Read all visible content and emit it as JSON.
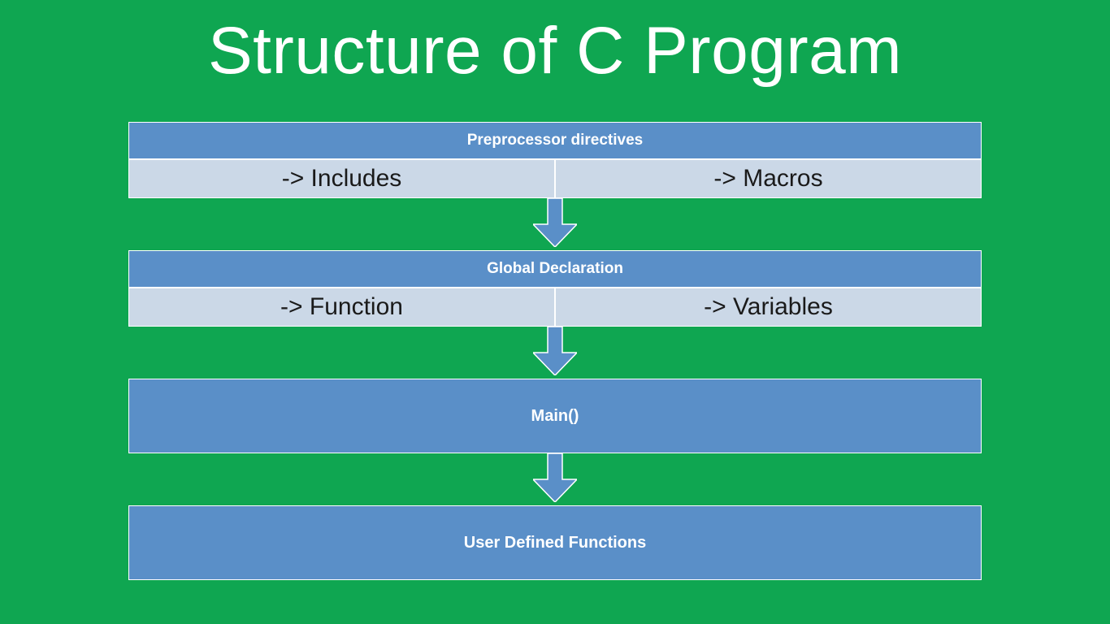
{
  "title": "Structure of C Program",
  "blocks": {
    "preprocessor": {
      "header": "Preprocessor directives",
      "left": "-> Includes",
      "right": "-> Macros"
    },
    "global": {
      "header": "Global Declaration",
      "left": "-> Function",
      "right": "-> Variables"
    },
    "main": {
      "label": "Main()"
    },
    "udf": {
      "label": "User Defined Functions"
    }
  },
  "colors": {
    "bg": "#0fa651",
    "blockFill": "#5a8fc8",
    "subFill": "#cbd8e7",
    "stroke": "#ffffff"
  }
}
